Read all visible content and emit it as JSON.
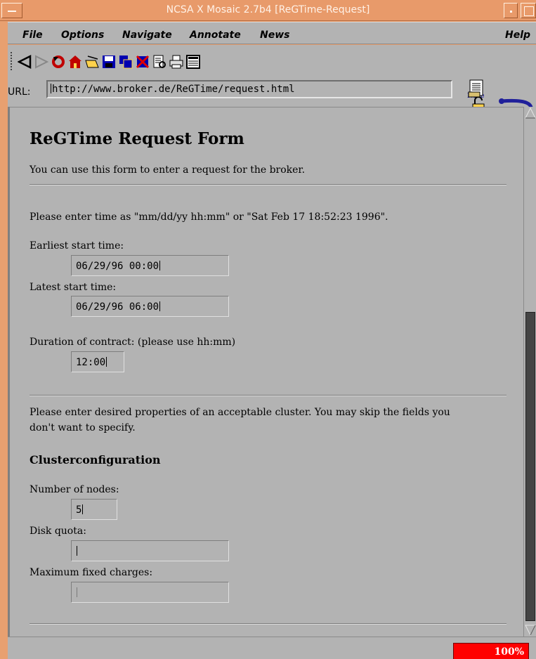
{
  "window": {
    "title": "NCSA X Mosaic 2.7b4 [ReGTime-Request]"
  },
  "menubar": {
    "file": "File",
    "options": "Options",
    "navigate": "Navigate",
    "annotate": "Annotate",
    "news": "News",
    "help": "Help"
  },
  "toolbar": {
    "icons": [
      "back-icon",
      "forward-icon",
      "reload-icon",
      "home-icon",
      "open-icon",
      "save-icon",
      "clone-icon",
      "close-window-icon",
      "print-preview-icon",
      "print-icon",
      "news-icon"
    ],
    "annotation_badge": "None"
  },
  "url": {
    "label": "URL:",
    "value": "http://www.broker.de/ReGTime/request.html"
  },
  "page": {
    "heading": "ReGTime Request Form",
    "intro": "You can use this form to enter a request for the broker.",
    "time_instructions": "Please enter time as \"mm/dd/yy hh:mm\" or \"Sat Feb 17 18:52:23 1996\".",
    "earliest_label": "Earliest start time:",
    "earliest_value": "06/29/96 00:00",
    "latest_label": "Latest start time:",
    "latest_value": "06/29/96 06:00",
    "duration_label": "Duration of contract: (please use hh:mm)",
    "duration_value": "12:00",
    "properties_line1": "Please enter desired properties of an acceptable cluster. You may skip the fields you",
    "properties_line2": "don't want to specify.",
    "cluster_heading": "Clusterconfiguration",
    "nodes_label": "Number of nodes:",
    "nodes_value": "5",
    "disk_label": "Disk quota:",
    "disk_value": "",
    "charges_label": "Maximum fixed charges:",
    "charges_value": ""
  },
  "status": {
    "progress_text": "100%",
    "progress_color": "#ff0000"
  },
  "colors": {
    "titlebar": "#e89a6a",
    "background": "#b3b3b3"
  }
}
